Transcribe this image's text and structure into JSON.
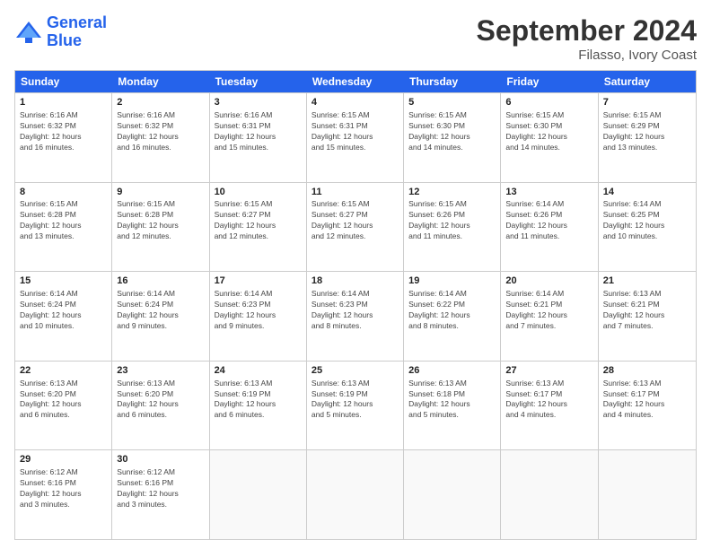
{
  "logo": {
    "line1": "General",
    "line2": "Blue"
  },
  "title": "September 2024",
  "subtitle": "Filasso, Ivory Coast",
  "days": [
    "Sunday",
    "Monday",
    "Tuesday",
    "Wednesday",
    "Thursday",
    "Friday",
    "Saturday"
  ],
  "rows": [
    [
      {
        "day": "1",
        "lines": [
          "Sunrise: 6:16 AM",
          "Sunset: 6:32 PM",
          "Daylight: 12 hours",
          "and 16 minutes."
        ]
      },
      {
        "day": "2",
        "lines": [
          "Sunrise: 6:16 AM",
          "Sunset: 6:32 PM",
          "Daylight: 12 hours",
          "and 16 minutes."
        ]
      },
      {
        "day": "3",
        "lines": [
          "Sunrise: 6:16 AM",
          "Sunset: 6:31 PM",
          "Daylight: 12 hours",
          "and 15 minutes."
        ]
      },
      {
        "day": "4",
        "lines": [
          "Sunrise: 6:15 AM",
          "Sunset: 6:31 PM",
          "Daylight: 12 hours",
          "and 15 minutes."
        ]
      },
      {
        "day": "5",
        "lines": [
          "Sunrise: 6:15 AM",
          "Sunset: 6:30 PM",
          "Daylight: 12 hours",
          "and 14 minutes."
        ]
      },
      {
        "day": "6",
        "lines": [
          "Sunrise: 6:15 AM",
          "Sunset: 6:30 PM",
          "Daylight: 12 hours",
          "and 14 minutes."
        ]
      },
      {
        "day": "7",
        "lines": [
          "Sunrise: 6:15 AM",
          "Sunset: 6:29 PM",
          "Daylight: 12 hours",
          "and 13 minutes."
        ]
      }
    ],
    [
      {
        "day": "8",
        "lines": [
          "Sunrise: 6:15 AM",
          "Sunset: 6:28 PM",
          "Daylight: 12 hours",
          "and 13 minutes."
        ]
      },
      {
        "day": "9",
        "lines": [
          "Sunrise: 6:15 AM",
          "Sunset: 6:28 PM",
          "Daylight: 12 hours",
          "and 12 minutes."
        ]
      },
      {
        "day": "10",
        "lines": [
          "Sunrise: 6:15 AM",
          "Sunset: 6:27 PM",
          "Daylight: 12 hours",
          "and 12 minutes."
        ]
      },
      {
        "day": "11",
        "lines": [
          "Sunrise: 6:15 AM",
          "Sunset: 6:27 PM",
          "Daylight: 12 hours",
          "and 12 minutes."
        ]
      },
      {
        "day": "12",
        "lines": [
          "Sunrise: 6:15 AM",
          "Sunset: 6:26 PM",
          "Daylight: 12 hours",
          "and 11 minutes."
        ]
      },
      {
        "day": "13",
        "lines": [
          "Sunrise: 6:14 AM",
          "Sunset: 6:26 PM",
          "Daylight: 12 hours",
          "and 11 minutes."
        ]
      },
      {
        "day": "14",
        "lines": [
          "Sunrise: 6:14 AM",
          "Sunset: 6:25 PM",
          "Daylight: 12 hours",
          "and 10 minutes."
        ]
      }
    ],
    [
      {
        "day": "15",
        "lines": [
          "Sunrise: 6:14 AM",
          "Sunset: 6:24 PM",
          "Daylight: 12 hours",
          "and 10 minutes."
        ]
      },
      {
        "day": "16",
        "lines": [
          "Sunrise: 6:14 AM",
          "Sunset: 6:24 PM",
          "Daylight: 12 hours",
          "and 9 minutes."
        ]
      },
      {
        "day": "17",
        "lines": [
          "Sunrise: 6:14 AM",
          "Sunset: 6:23 PM",
          "Daylight: 12 hours",
          "and 9 minutes."
        ]
      },
      {
        "day": "18",
        "lines": [
          "Sunrise: 6:14 AM",
          "Sunset: 6:23 PM",
          "Daylight: 12 hours",
          "and 8 minutes."
        ]
      },
      {
        "day": "19",
        "lines": [
          "Sunrise: 6:14 AM",
          "Sunset: 6:22 PM",
          "Daylight: 12 hours",
          "and 8 minutes."
        ]
      },
      {
        "day": "20",
        "lines": [
          "Sunrise: 6:14 AM",
          "Sunset: 6:21 PM",
          "Daylight: 12 hours",
          "and 7 minutes."
        ]
      },
      {
        "day": "21",
        "lines": [
          "Sunrise: 6:13 AM",
          "Sunset: 6:21 PM",
          "Daylight: 12 hours",
          "and 7 minutes."
        ]
      }
    ],
    [
      {
        "day": "22",
        "lines": [
          "Sunrise: 6:13 AM",
          "Sunset: 6:20 PM",
          "Daylight: 12 hours",
          "and 6 minutes."
        ]
      },
      {
        "day": "23",
        "lines": [
          "Sunrise: 6:13 AM",
          "Sunset: 6:20 PM",
          "Daylight: 12 hours",
          "and 6 minutes."
        ]
      },
      {
        "day": "24",
        "lines": [
          "Sunrise: 6:13 AM",
          "Sunset: 6:19 PM",
          "Daylight: 12 hours",
          "and 6 minutes."
        ]
      },
      {
        "day": "25",
        "lines": [
          "Sunrise: 6:13 AM",
          "Sunset: 6:19 PM",
          "Daylight: 12 hours",
          "and 5 minutes."
        ]
      },
      {
        "day": "26",
        "lines": [
          "Sunrise: 6:13 AM",
          "Sunset: 6:18 PM",
          "Daylight: 12 hours",
          "and 5 minutes."
        ]
      },
      {
        "day": "27",
        "lines": [
          "Sunrise: 6:13 AM",
          "Sunset: 6:17 PM",
          "Daylight: 12 hours",
          "and 4 minutes."
        ]
      },
      {
        "day": "28",
        "lines": [
          "Sunrise: 6:13 AM",
          "Sunset: 6:17 PM",
          "Daylight: 12 hours",
          "and 4 minutes."
        ]
      }
    ],
    [
      {
        "day": "29",
        "lines": [
          "Sunrise: 6:12 AM",
          "Sunset: 6:16 PM",
          "Daylight: 12 hours",
          "and 3 minutes."
        ]
      },
      {
        "day": "30",
        "lines": [
          "Sunrise: 6:12 AM",
          "Sunset: 6:16 PM",
          "Daylight: 12 hours",
          "and 3 minutes."
        ]
      },
      {
        "day": "",
        "lines": []
      },
      {
        "day": "",
        "lines": []
      },
      {
        "day": "",
        "lines": []
      },
      {
        "day": "",
        "lines": []
      },
      {
        "day": "",
        "lines": []
      }
    ]
  ]
}
